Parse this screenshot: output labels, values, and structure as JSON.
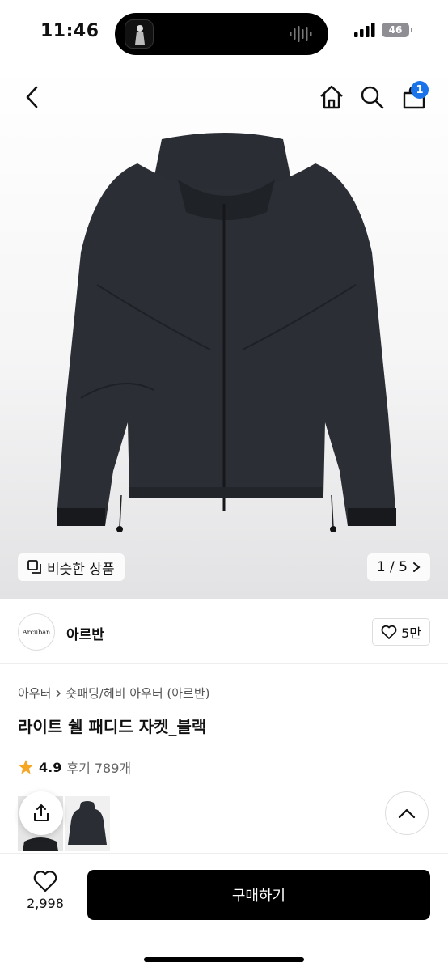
{
  "status_bar": {
    "time": "11:46",
    "battery": "46"
  },
  "header": {
    "cart_count": "1"
  },
  "hero": {
    "similar_label": "비슷한 상품",
    "page_indicator": "1 / 5"
  },
  "brand": {
    "logo_text": "Arcuban",
    "name": "아르반",
    "likes": "5만"
  },
  "product": {
    "breadcrumb": [
      "아우터",
      "숏패딩/헤비 아우터 (아르반)"
    ],
    "title": "라이트 쉘 패디드 자켓_블랙",
    "rating": "4.9",
    "reviews": "후기 789개"
  },
  "bottom": {
    "wish_count": "2,998",
    "buy_label": "구매하기"
  },
  "colors": {
    "accent": "#1a73e8",
    "star": "#f5a623",
    "button": "#000000"
  },
  "icons": [
    "back-icon",
    "home-icon",
    "search-icon",
    "cart-icon",
    "copy-icon",
    "chevron-right-icon",
    "heart-icon",
    "star-icon",
    "share-icon",
    "chevron-up-icon"
  ]
}
